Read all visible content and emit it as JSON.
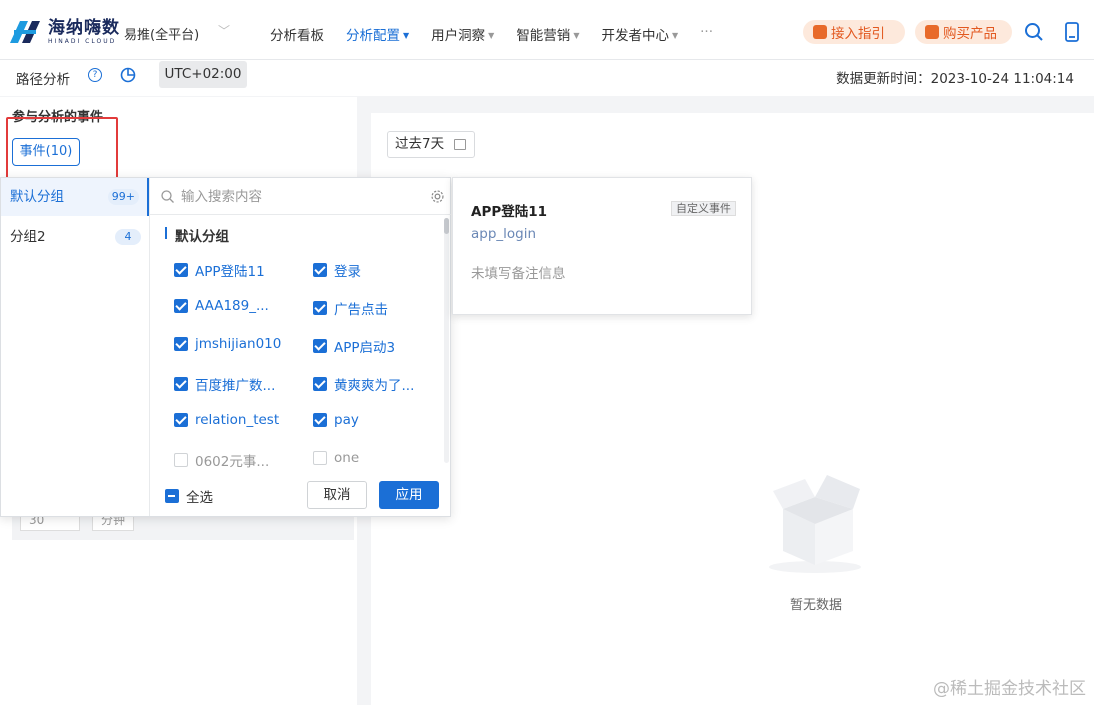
{
  "nav": {
    "brand_text": "海纳嗨数",
    "brand_sub": "HINADI CLOUD",
    "project": "易推(全平台)",
    "menu": [
      {
        "label": "分析看板",
        "has_caret": false,
        "active": false
      },
      {
        "label": "分析配置",
        "has_caret": true,
        "active": true
      },
      {
        "label": "用户洞察",
        "has_caret": true,
        "active": false
      },
      {
        "label": "智能营销",
        "has_caret": true,
        "active": false
      },
      {
        "label": "开发者中心",
        "has_caret": true,
        "active": false
      }
    ],
    "more": "···",
    "guide_label": "接入指引",
    "buy_label": "购买产品"
  },
  "subheader": {
    "title": "路径分析",
    "help": "?",
    "timezone": "UTC+02:00",
    "updated": "数据更新时间：2023-10-24 11:04:14"
  },
  "left": {
    "section_label": "参与分析的事件",
    "events_button": "事件(10)",
    "ghost_input": "30",
    "ghost_button": "分钟"
  },
  "dropdown": {
    "groups": [
      {
        "label": "默认分组",
        "count": "99+"
      },
      {
        "label": "分组2",
        "count": "4"
      }
    ],
    "search_placeholder": "输入搜索内容",
    "group_title": "默认分组",
    "events": [
      {
        "label": "APP登陆11",
        "checked": true
      },
      {
        "label": "登录",
        "checked": true
      },
      {
        "label": "AAA189_...",
        "checked": true
      },
      {
        "label": "广告点击",
        "checked": true
      },
      {
        "label": "jmshijian010",
        "checked": true
      },
      {
        "label": "APP启动3",
        "checked": true
      },
      {
        "label": "百度推广数...",
        "checked": true
      },
      {
        "label": "黄爽爽为了...",
        "checked": true
      },
      {
        "label": "relation_test",
        "checked": true
      },
      {
        "label": "pay",
        "checked": true
      },
      {
        "label": "0602元事...",
        "checked": false
      },
      {
        "label": "one",
        "checked": false
      }
    ],
    "select_all": "全选",
    "cancel": "取消",
    "apply": "应用"
  },
  "detail": {
    "name": "APP登陆11",
    "tag": "自定义事件",
    "id": "app_login",
    "note": "未填写备注信息"
  },
  "right": {
    "date_range": "过去7天",
    "empty_text": "暂无数据"
  },
  "watermark": "@稀土掘金技术社区",
  "colors": {
    "accent": "#1b6fd6",
    "orange": "#e2581f",
    "highlight_box": "#e23b3b"
  }
}
